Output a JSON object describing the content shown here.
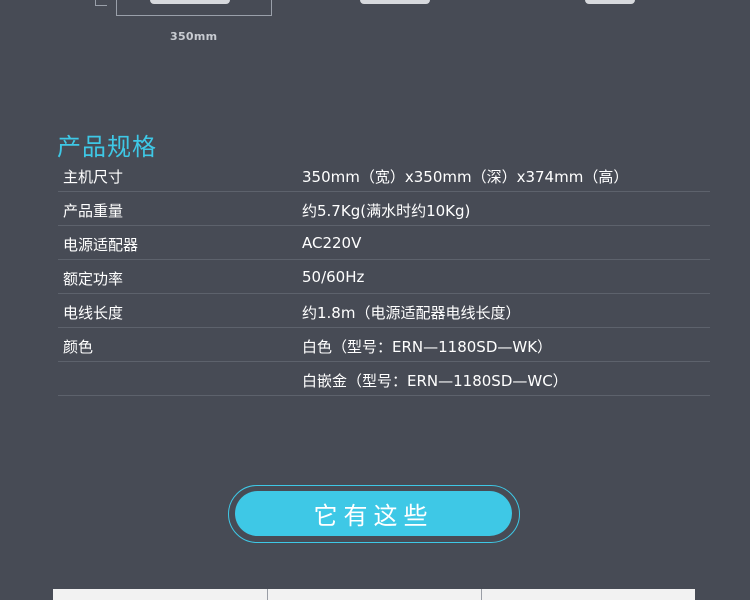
{
  "dimension": {
    "label": "350mm"
  },
  "spec": {
    "title": "产品规格",
    "rows": [
      {
        "label": "主机尺寸",
        "value": "350mm（宽）x350mm（深）x374mm（高）"
      },
      {
        "label": "产品重量",
        "value": "约5.7Kg(满水时约10Kg)"
      },
      {
        "label": "电源适配器",
        "value": "AC220V"
      },
      {
        "label": "额定功率",
        "value": "50/60Hz"
      },
      {
        "label": "电线长度",
        "value": "约1.8m（电源适配器电线长度）"
      },
      {
        "label": "颜色",
        "value": "白色（型号：ERN—1180SD—WK）"
      },
      {
        "label": "",
        "value": "白嵌金（型号：ERN—1180SD—WC）"
      }
    ]
  },
  "cta": {
    "label": "它有这些"
  },
  "colors": {
    "background": "#474b55",
    "accent": "#3ec8e6",
    "row_divider": "#5d626c"
  }
}
